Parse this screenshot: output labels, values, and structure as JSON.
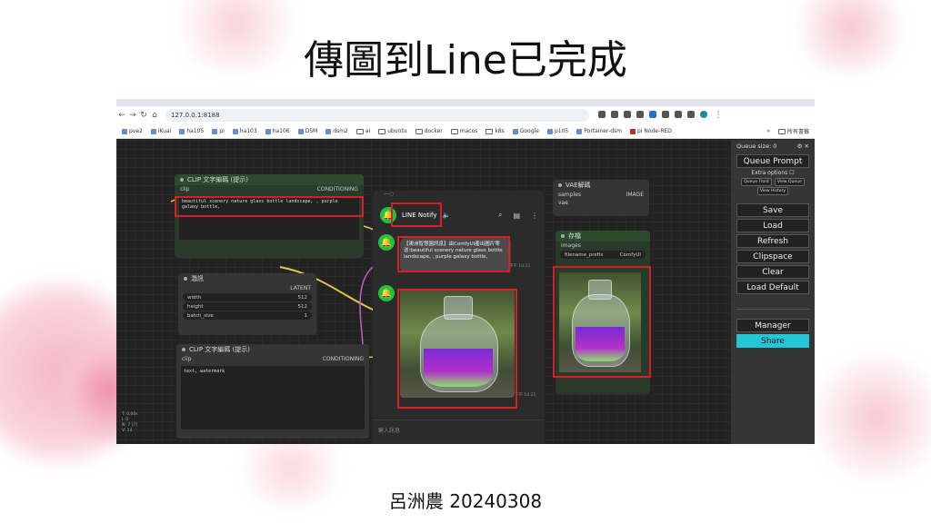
{
  "slide": {
    "title": "傳圖到Line已完成",
    "author": "呂洲農 20240308"
  },
  "browser": {
    "url": "127.0.0.1:8188",
    "bookmarks": [
      "pve2",
      "iKuai",
      "ha105",
      "pi",
      "ha103",
      "ha106",
      "DSM",
      "dsm2",
      "ai",
      "ubuntu",
      "docker",
      "macos",
      "k8s",
      "Google",
      "p105",
      "Portainer-dsm",
      "pi Node-RED"
    ],
    "all_bookmarks": "所有書籤"
  },
  "nodes": {
    "clip_positive": {
      "title": "CLIP 文字編碼 (提示)",
      "input": "clip",
      "output": "CONDITIONING",
      "text": "beautiful scenery nature glass bottle landscape, , purple galaxy bottle,"
    },
    "latent": {
      "title": "潛訊",
      "output": "LATENT",
      "width_label": "width",
      "width": "512",
      "height_label": "height",
      "height": "512",
      "batch_label": "batch_size",
      "batch": "1"
    },
    "clip_negative": {
      "title": "CLIP 文字編碼 (提示)",
      "input": "clip",
      "output": "CONDITIONING",
      "text": "text, watermark"
    },
    "vae": {
      "title": "VAE解碼",
      "input1": "samples",
      "input2": "vae",
      "output": "IMAGE"
    },
    "save": {
      "title": "存檔",
      "input": "images",
      "prefix_label": "filename_prefix",
      "prefix_value": "ComfyUI"
    }
  },
  "line": {
    "chat_name": "LINE Notify",
    "message": "【澳洲智慧園訊息】由ComfyUI產出圖片零送:beautiful scenery nature glass bottle landscape, , purple galaxy bottle,",
    "time1": "下午 10:21",
    "time2": "下午 10:21",
    "input_placeholder": "輸入訊息"
  },
  "menu": {
    "queue_size": "Queue size: 0",
    "queue_prompt": "Queue Prompt",
    "extra_options": "Extra options",
    "queue_front": "Queue Front",
    "view_queue": "View Queue",
    "view_history": "View History",
    "save": "Save",
    "load": "Load",
    "refresh": "Refresh",
    "clipspace": "Clipspace",
    "clear": "Clear",
    "load_default": "Load Default",
    "manager": "Manager",
    "share": "Share"
  },
  "stats": [
    "T: 0.00s",
    "I: 0",
    "N: 7 [7]",
    "V: 14"
  ],
  "colors": {
    "accent_red": "#d61f26",
    "line_green": "#1fc33e",
    "share_bg": "#24c7d8"
  }
}
